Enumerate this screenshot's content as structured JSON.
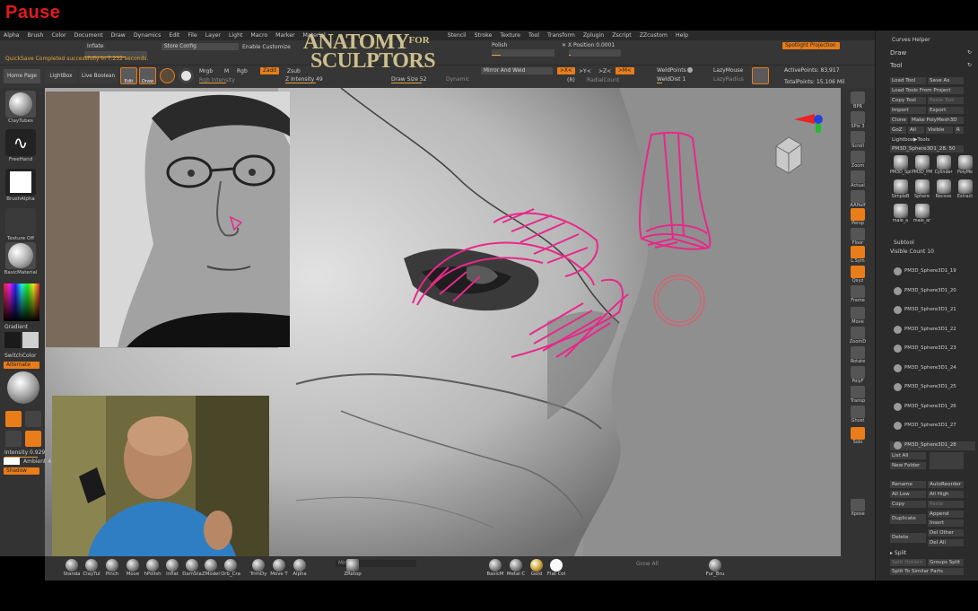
{
  "overlay": {
    "pause_label": "Pause"
  },
  "menu": [
    "Alpha",
    "Brush",
    "Color",
    "Document",
    "Draw",
    "Dynamics",
    "Edit",
    "File",
    "Layer",
    "Light",
    "Macro",
    "Marker",
    "Material",
    "Stencil",
    "Stroke",
    "Texture",
    "Tool",
    "Transform",
    "Zplugin",
    "Zscript",
    "ZZcustom",
    "Help"
  ],
  "toolbar": {
    "inflate": "Inflate",
    "store_config": "Store Config",
    "enable_customize": "Enable Customize",
    "polish": "Polish",
    "x_position": "X Position",
    "x_position_value": "0.0001",
    "spotlight_projection": "Spotlight Projection",
    "quicksave": "QuickSave Completed successfully in 7.232 seconds.",
    "home_page": "Home Page",
    "lightbox": "LightBox",
    "live_boolean": "Live Boolean",
    "edit": "Edit",
    "draw": "Draw",
    "mrgb": "Mrgb",
    "m": "M",
    "rgb": "Rgb",
    "zadd": "Zadd",
    "zsub": "Zsub",
    "rgb_intensity": "Rgb Intensity",
    "z_intensity": "Z Intensity",
    "z_intensity_value": "49",
    "mirror_and_weld": "Mirror And Weld",
    "x_axis": ">X<",
    "y_axis": ">Y<",
    "z_axis": ">Z<",
    "m_axis": ">M<",
    "r": "(R)",
    "radial_count": "RadialCount",
    "weld_points": "WeldPoints",
    "weld_dist": "WeldDist",
    "weld_dist_value": "1",
    "lazy_mouse": "LazyMouse",
    "lazy_radius": "LazyRadius",
    "draw_size": "Draw Size",
    "draw_size_value": "52",
    "dynamic": "Dynamic",
    "active_points": "ActivePoints: 83,917",
    "total_points": "TotalPoints: 15.106 Mil"
  },
  "logo": {
    "line1": "ANATOMY",
    "for": "FOR",
    "line2": "SCULPTORS"
  },
  "left_shelf": {
    "brush": "ClayTubes",
    "stroke": "FreeHand",
    "alpha": "BrushAlpha",
    "texture": "Texture Off",
    "material": "BasicMaterial",
    "gradient": "Gradient",
    "switch_color": "SwitchColor",
    "alternate": "Alternate",
    "intensity": "Intensity",
    "intensity_value": "0.929",
    "ambient": "Ambient",
    "ambient_value": "4",
    "shadow": "Shadow"
  },
  "nav": [
    "BPR",
    "SPix 3",
    "Scroll",
    "Zoom",
    "Actual",
    "AAHalf",
    "Persp",
    "Floor",
    "L.Sym",
    "Qxyz",
    "Frame",
    "Move",
    "ZoomD",
    "Rotate",
    "PolyF",
    "Transp",
    "Ghost",
    "Solo",
    "Xpose"
  ],
  "right_panel": {
    "curves_helper": "Curves Helper",
    "draw": "Draw",
    "tool": "Tool",
    "load_tool": "Load Tool",
    "save_as": "Save As",
    "load_from_project": "Load Tools From Project",
    "copy_tool": "Copy Tool",
    "paste_tool": "Paste Tool",
    "import": "Import",
    "export": "Export",
    "clone": "Clone",
    "make_polymesh": "Make PolyMesh3D",
    "goz": "GoZ",
    "all": "All",
    "visible": "Visible",
    "r": "R",
    "lightbox_tools": "Lightbox▶Tools",
    "current_tool": "PM3D_Sphere3D1_28. 50",
    "tool_thumbs": [
      "PM3D_Sphere3",
      "PM3D_PM3D_",
      "Cylinder",
      "PolyMe",
      "SimpleB",
      "Sphere",
      "Recove",
      "Extract",
      "male_a",
      "male_ar"
    ],
    "subtool": "Subtool",
    "visible_count": "Visible Count",
    "visible_count_value": "10",
    "subtools": [
      "PM3D_Sphere3D1_19",
      "PM3D_Sphere3D1_20",
      "PM3D_Sphere3D1_21",
      "PM3D_Sphere3D1_22",
      "PM3D_Sphere3D1_23",
      "PM3D_Sphere3D1_24",
      "PM3D_Sphere3D1_25",
      "PM3D_Sphere3D1_26",
      "PM3D_Sphere3D1_27",
      "PM3D_Sphere3D1_28"
    ],
    "list_all": "List All",
    "new_folder": "New Folder",
    "rename": "Rename",
    "auto_reorder": "AutoReorder",
    "all_low": "All Low",
    "all_high": "All High",
    "copy": "Copy",
    "paste": "Paste",
    "append": "Append",
    "duplicate": "Duplicate",
    "insert": "Insert",
    "delete": "Delete",
    "del_other": "Del Other",
    "del_all": "Del All",
    "split": "Split",
    "split_hidden": "Split Hidden",
    "groups_split": "Groups Split",
    "split_to_similar": "Split To Similar Parts"
  },
  "bottom_shelf": {
    "brushes": [
      "Standa",
      "ClayTul",
      "Pinch",
      "Move",
      "hPolish",
      "Inflat",
      "DamSta",
      "ZModel",
      "Orb_Cra",
      "TrimDy",
      "Move T",
      "Alpha"
    ],
    "zretop": "ZRetop",
    "mirror": "Mirror",
    "materials": [
      "BasicM",
      "Metal C",
      "Gold",
      "Flat Col"
    ],
    "grow_all": "Grow All",
    "fur": "Fur_Bru"
  },
  "colors": {
    "accent": "#e87d1a",
    "sketch_pink": "#e8288a",
    "pause_red": "#e31b1b"
  }
}
